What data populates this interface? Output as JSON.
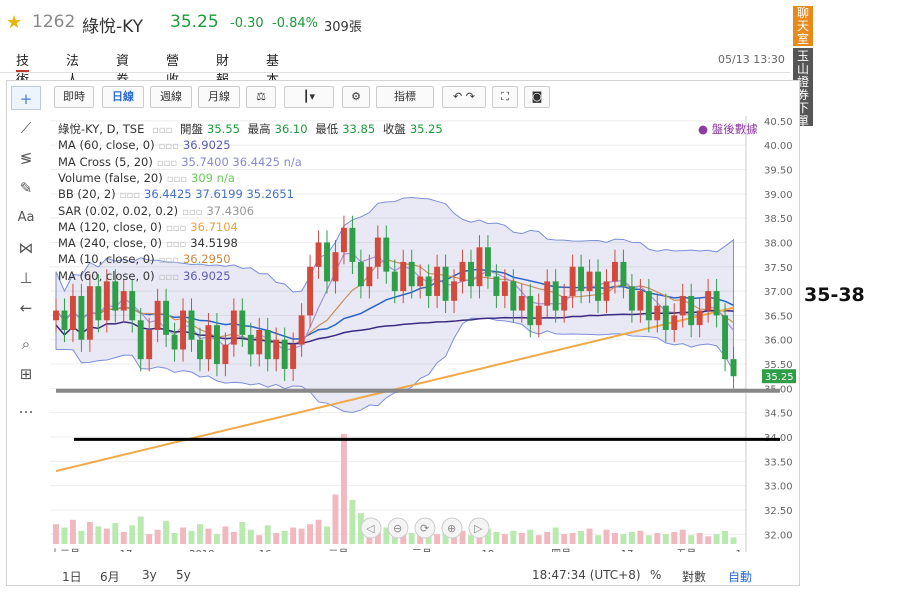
{
  "header": {
    "code": "1262",
    "name": "綠悅-KY",
    "price": "35.25",
    "change": "-0.30",
    "change_pct": "-0.84%",
    "volume": "309張"
  },
  "tabs": [
    {
      "label": "技術",
      "active": true
    },
    {
      "label": "法人"
    },
    {
      "label": "資券"
    },
    {
      "label": "營收"
    },
    {
      "label": "財報"
    },
    {
      "label": "基本"
    }
  ],
  "datetime": "05/13 13:30",
  "side": {
    "chat": "聊天室",
    "trade": "玉山證券下單"
  },
  "annotation": "35-38",
  "toolbar": {
    "buttons": [
      "即時",
      "日線",
      "週線",
      "月線"
    ],
    "selected": "日線",
    "indicator": "指標"
  },
  "legend": {
    "main": {
      "label": "綠悅-KY, D, TSE",
      "open_label": "開盤",
      "open": "35.55",
      "high_label": "最高",
      "high": "36.10",
      "low_label": "最低",
      "low": "33.85",
      "close_label": "收盤",
      "close": "35.25"
    },
    "after_hours": "盤後數據",
    "rows": [
      {
        "label": "MA (60, close, 0)",
        "values": "36.9025",
        "color": "#5a5ab8"
      },
      {
        "label": "MA Cross (5, 20)",
        "values": "35.7400 36.4425 n/a",
        "color": "#8a8ad0"
      },
      {
        "label": "Volume (false, 20)",
        "values": "309 n/a",
        "color": "#66cc55"
      },
      {
        "label": "BB (20, 2)",
        "values": "36.4425 37.6199 35.2651",
        "color": "#4472c4"
      },
      {
        "label": "SAR (0.02, 0.02, 0.2)",
        "values": "37.4306",
        "color": "#999999"
      },
      {
        "label": "MA (120, close, 0)",
        "values": "36.7104",
        "color": "#e8a33a"
      },
      {
        "label": "MA (240, close, 0)",
        "values": "34.5198",
        "color": "#333333"
      },
      {
        "label": "MA (10, close, 0)",
        "values": "36.2950",
        "color": "#cc8844"
      },
      {
        "label": "MA (60, close, 0)",
        "values": "36.9025",
        "color": "#5a5ab8"
      }
    ]
  },
  "chart_data": {
    "type": "candlestick",
    "y_ticks": [
      "40.50",
      "40.00",
      "39.50",
      "39.00",
      "38.50",
      "38.00",
      "37.50",
      "37.00",
      "36.50",
      "36.00",
      "35.50",
      "35.00",
      "34.50",
      "34.00",
      "33.50",
      "33.00",
      "32.50",
      "32.00"
    ],
    "ylim": [
      31.8,
      40.6
    ],
    "x_ticks": [
      "十二月",
      "17",
      "2019",
      "16",
      "二月",
      "三月",
      "18",
      "四月",
      "17",
      "五月",
      "1"
    ],
    "current_price": "35.25",
    "horizontal_lines": [
      {
        "price": 34.95,
        "color": "#888888"
      },
      {
        "price": 33.95,
        "color": "#000000"
      }
    ],
    "closes": [
      36.6,
      36.2,
      36.9,
      36.0,
      37.1,
      36.4,
      37.2,
      36.6,
      37.0,
      36.4,
      35.6,
      36.2,
      36.8,
      36.1,
      35.8,
      36.6,
      36.0,
      35.6,
      36.3,
      35.5,
      35.9,
      36.6,
      36.1,
      35.7,
      36.2,
      35.6,
      36.0,
      35.4,
      35.9,
      36.5,
      37.5,
      38.0,
      37.2,
      37.8,
      38.3,
      37.6,
      37.1,
      37.5,
      38.1,
      37.4,
      37.0,
      37.6,
      37.1,
      37.3,
      36.9,
      37.5,
      36.8,
      37.2,
      37.6,
      37.1,
      37.9,
      37.3,
      36.9,
      37.2,
      36.6,
      36.9,
      36.3,
      36.7,
      37.2,
      36.6,
      36.9,
      37.5,
      37.0,
      37.4,
      36.8,
      37.2,
      37.6,
      37.1,
      36.6,
      37.0,
      36.4,
      36.7,
      36.2,
      36.5,
      36.9,
      36.3,
      36.6,
      37.0,
      36.5,
      35.6,
      35.25
    ],
    "volume_scale_max": 100,
    "volumes": [
      18,
      15,
      22,
      12,
      20,
      16,
      14,
      19,
      11,
      17,
      25,
      9,
      13,
      21,
      10,
      15,
      12,
      18,
      14,
      9,
      16,
      11,
      20,
      13,
      8,
      17,
      10,
      12,
      15,
      14,
      18,
      22,
      16,
      45,
      100,
      40,
      28,
      20,
      18,
      15,
      12,
      14,
      10,
      16,
      11,
      9,
      13,
      15,
      12,
      8,
      10,
      14,
      11,
      9,
      12,
      10,
      13,
      8,
      11,
      15,
      9,
      10,
      12,
      14,
      8,
      13,
      10,
      9,
      11,
      12,
      8,
      10,
      9,
      11,
      13,
      8,
      10,
      7,
      9,
      12,
      6
    ]
  }
}
